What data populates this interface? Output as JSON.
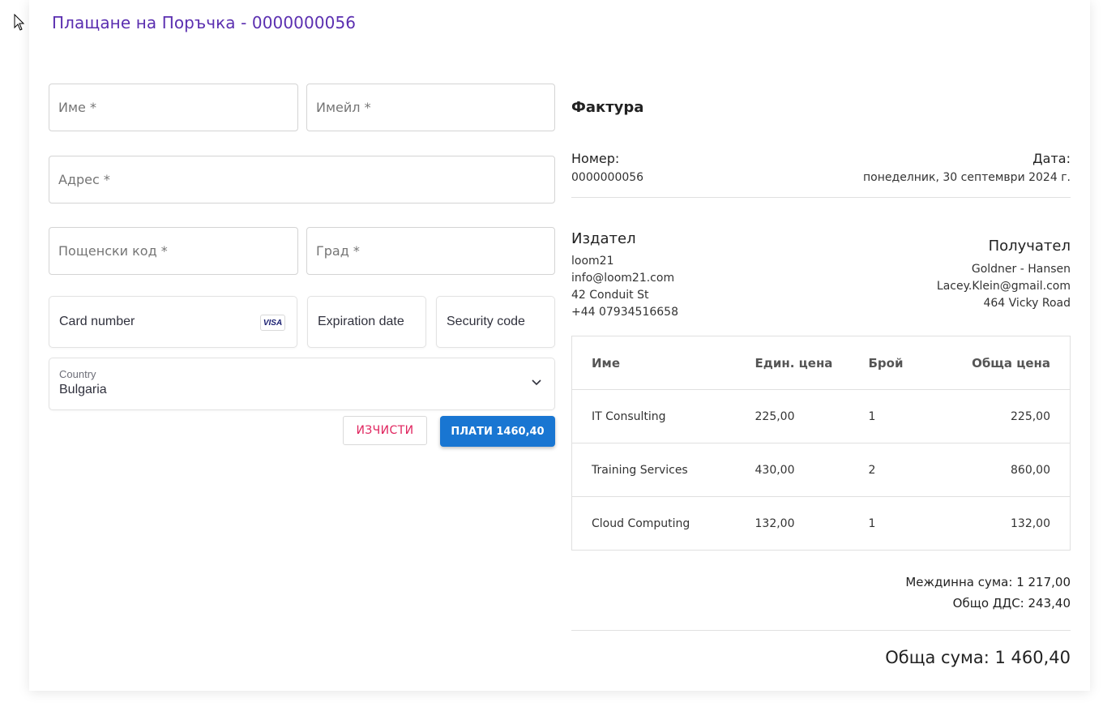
{
  "header": {
    "title": "Плащане на Поръчка - 0000000056"
  },
  "form": {
    "name_placeholder": "Име *",
    "email_placeholder": "Имейл *",
    "address_placeholder": "Адрес *",
    "zip_placeholder": "Пощенски код *",
    "city_placeholder": "Град *"
  },
  "payment": {
    "card_number_placeholder": "Card number",
    "card_brand": "VISA",
    "expiration_placeholder": "Expiration date",
    "security_placeholder": "Security code",
    "country_label": "Country",
    "country_value": "Bulgaria"
  },
  "buttons": {
    "clear_label": "ИЗЧИСТИ",
    "pay_label": "ПЛАТИ 1460,40"
  },
  "invoice": {
    "title": "Фактура",
    "number_label": "Номер:",
    "number_value": "0000000056",
    "date_label": "Дата:",
    "date_value": "понеделник, 30 септември 2024 г.",
    "issuer": {
      "title": "Издател",
      "lines": [
        "loom21",
        "info@loom21.com",
        "42 Conduit St",
        "+44 07934516658"
      ]
    },
    "recipient": {
      "title": "Получател",
      "lines": [
        "Goldner - Hansen",
        "Lacey.Klein@gmail.com",
        "464 Vicky Road"
      ]
    },
    "table": {
      "headers": [
        "Име",
        "Един. цена",
        "Брой",
        "Обща цена"
      ],
      "rows": [
        [
          "IT Consulting",
          "225,00",
          "1",
          "225,00"
        ],
        [
          "Training Services",
          "430,00",
          "2",
          "860,00"
        ],
        [
          "Cloud Computing",
          "132,00",
          "1",
          "132,00"
        ]
      ]
    },
    "subtotal": "Междинна сума: 1 217,00",
    "vat": "Общо ДДС: 243,40",
    "total": "Обща сума: 1 460,40"
  },
  "colors": {
    "title": "#5b2fb0",
    "pay_button": "#1976d2",
    "clear_button_text": "#e0245e"
  }
}
